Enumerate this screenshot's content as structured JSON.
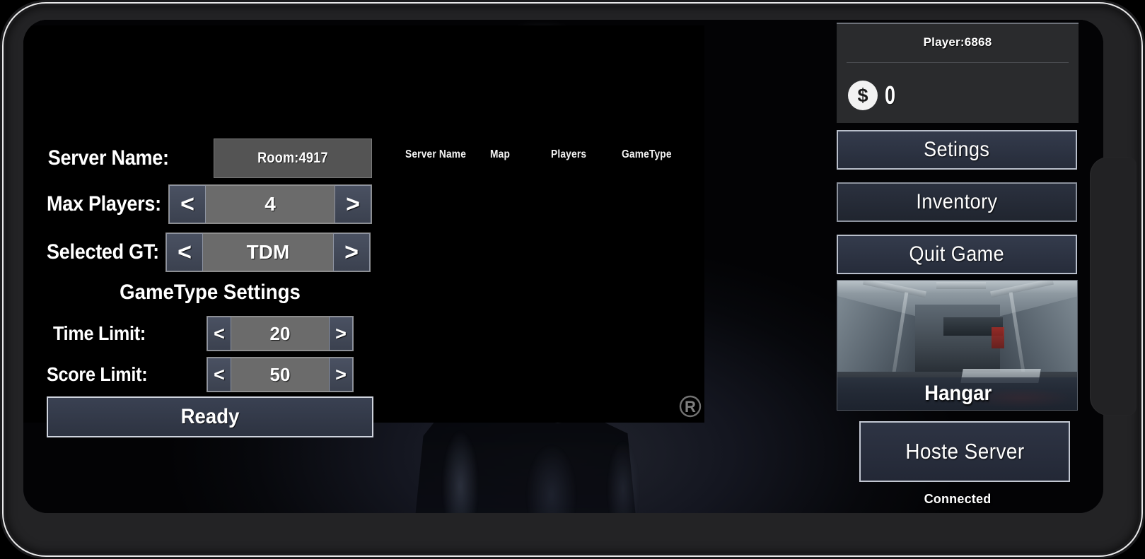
{
  "screen": {
    "background_art": "dark soldier helmet and silhouette"
  },
  "server_browser": {
    "columns": [
      {
        "id": "server-name",
        "label": "Server Name"
      },
      {
        "id": "map",
        "label": "Map"
      },
      {
        "id": "players",
        "label": "Players"
      },
      {
        "id": "gametype",
        "label": "GameType"
      }
    ],
    "rows": [],
    "watermark": "r-circle-logo"
  },
  "settings_panel": {
    "server_name": {
      "label": "Server Name:",
      "value": "Room:4917"
    },
    "max_players": {
      "label": "Max Players:",
      "value": "4",
      "prev": "<",
      "next": ">"
    },
    "selected_gametype": {
      "label": "Selected GT:",
      "value": "TDM",
      "prev": "<",
      "next": ">"
    },
    "gametype_settings_title": "GameType Settings",
    "time_limit": {
      "label": "Time Limit:",
      "value": "20",
      "prev": "<",
      "next": ">"
    },
    "score_limit": {
      "label": "Score Limit:",
      "value": "50",
      "prev": "<",
      "next": ">"
    },
    "ready_label": "Ready"
  },
  "sidebar": {
    "player_name": "Player:6868",
    "currency": {
      "icon": "dollar-coin-icon",
      "value": "0"
    },
    "buttons": [
      {
        "id": "settings",
        "label": "Setings"
      },
      {
        "id": "inventory",
        "label": "Inventory"
      },
      {
        "id": "quit-game",
        "label": "Quit Game"
      }
    ],
    "map_card": {
      "name": "Hangar"
    },
    "host_server_label": "Hoste Server",
    "connection_status": "Connected"
  },
  "colors": {
    "screen_bg": "#050507",
    "panel_button": "#343b4c",
    "panel_button_border": "#b9bfcb",
    "stepper_arrow": "#4a5162",
    "stepper_value_bg": "#6b6b6b",
    "field_bg": "#545454",
    "player_box_bg": "#2a2b2d",
    "text": "#ffffff",
    "coin": "#f2f2f2"
  }
}
